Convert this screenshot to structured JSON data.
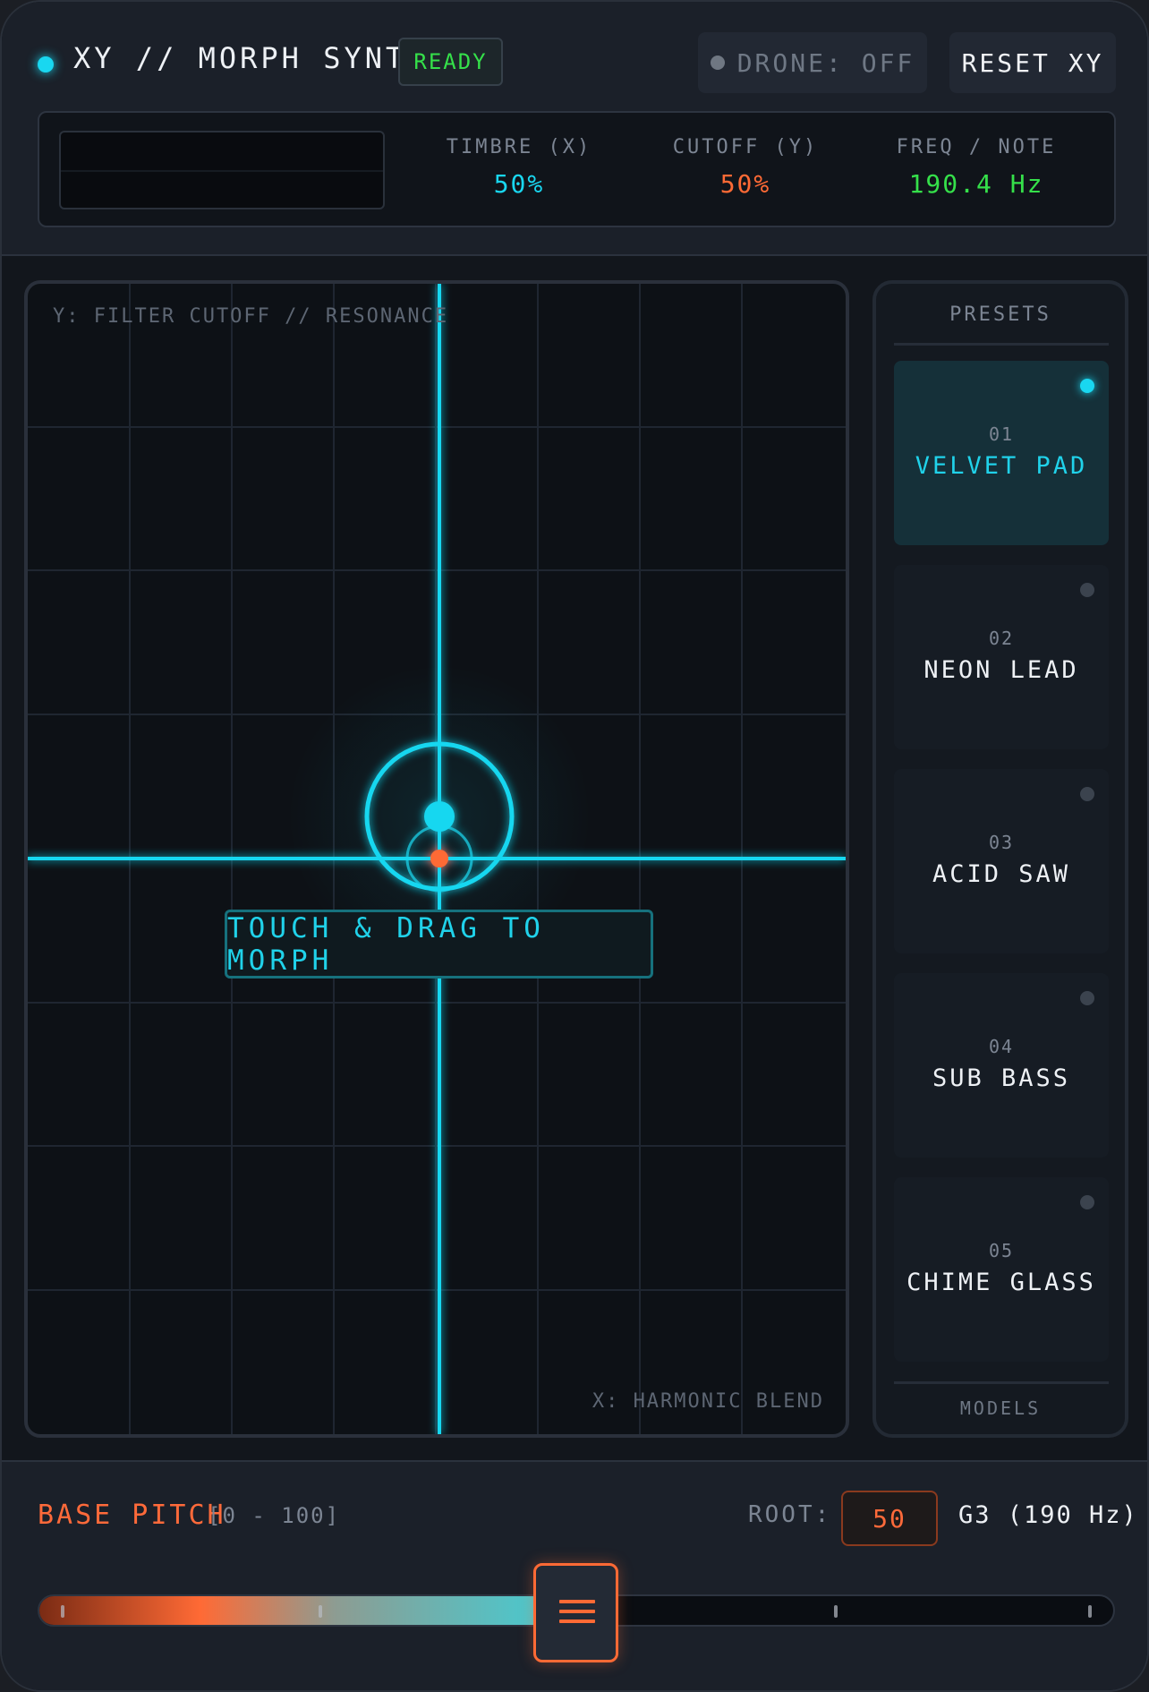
{
  "header": {
    "title": "XY // MORPH SYNTH",
    "status_badge": "READY",
    "drone_label": "DRONE: OFF",
    "reset_label": "RESET XY"
  },
  "readout": {
    "timbre": {
      "label": "TIMBRE (X)",
      "value": "50%"
    },
    "cutoff": {
      "label": "CUTOFF (Y)",
      "value": "50%"
    },
    "freq": {
      "label": "FREQ / NOTE",
      "value": "190.4 Hz"
    }
  },
  "pad": {
    "y_axis_label": "Y: FILTER CUTOFF // RESONANCE",
    "x_axis_label": "X: HARMONIC BLEND",
    "hint": "TOUCH & DRAG TO MORPH",
    "x_value": 0.5,
    "y_value": 0.5
  },
  "presets": {
    "title": "PRESETS",
    "footer_label": "MODELS",
    "items": [
      {
        "num": "01",
        "name": "VELVET PAD",
        "active": true
      },
      {
        "num": "02",
        "name": "NEON LEAD",
        "active": false
      },
      {
        "num": "03",
        "name": "ACID SAW",
        "active": false
      },
      {
        "num": "04",
        "name": "SUB BASS",
        "active": false
      },
      {
        "num": "05",
        "name": "CHIME GLASS",
        "active": false
      }
    ]
  },
  "pitch": {
    "label": "BASE PITCH",
    "range": "[0 - 100]",
    "root_label": "ROOT:",
    "root_value": "50",
    "root_note": "G3 (190 Hz)",
    "slider_value": 50
  },
  "colors": {
    "accent_cyan": "#19d7f0",
    "accent_orange": "#ff6a35",
    "status_green": "#35e04a"
  }
}
